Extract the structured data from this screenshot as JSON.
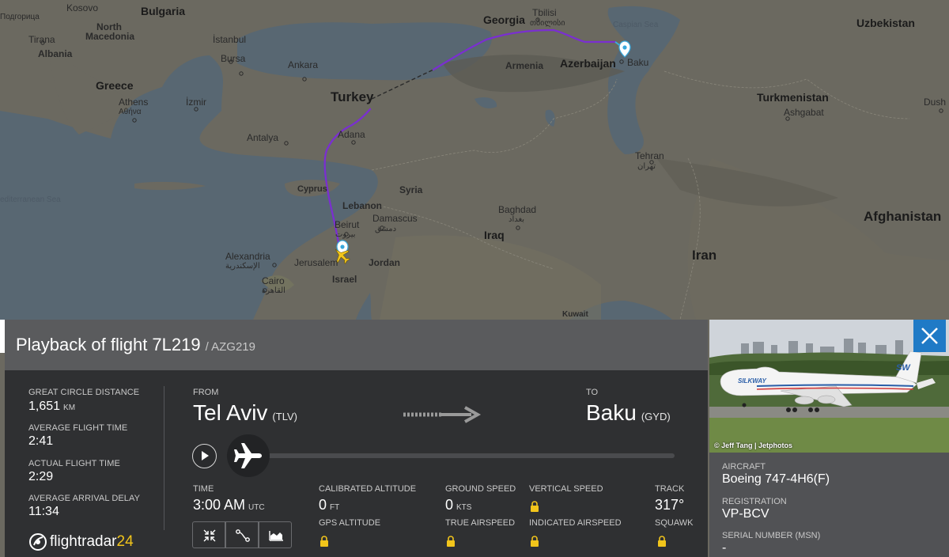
{
  "map": {
    "labels": {
      "kosovo": "Kosovo",
      "bulgaria": "Bulgaria",
      "north_macedonia": "North\nMacedonia",
      "podgorica": "Подгорица",
      "tirana": "Tirana",
      "albania": "Albania",
      "istanbul": "İstanbul",
      "bursa": "Bursa",
      "ankara": "Ankara",
      "izmir": "İzmir",
      "greece": "Greece",
      "athens": "Athens",
      "athens_local": "Αθήνα",
      "turkey": "Turkey",
      "antalya": "Antalya",
      "adana": "Adana",
      "cyprus": "Cyprus",
      "med_sea": "editerranean Sea",
      "syria": "Syria",
      "lebanon": "Lebanon",
      "beirut": "Beirut",
      "beirut_local": "بيروت",
      "damascus": "Damascus",
      "damascus_local": "دمشق",
      "alexandria": "Alexandria",
      "alexandria_local": "الإسكندرية",
      "jerusalem": "Jerusalem",
      "israel": "Israel",
      "jordan": "Jordan",
      "cairo": "Cairo",
      "cairo_local": "القاهرة",
      "georgia": "Georgia",
      "tbilisi": "Tbilisi",
      "tbilisi_local": "თბილისი",
      "armenia": "Armenia",
      "azerbaijan": "Azerbaijan",
      "baku": "Baku",
      "caspian_sea": "Caspian Sea",
      "baghdad": "Baghdad",
      "baghdad_local": "بغداد",
      "iraq": "Iraq",
      "iran": "Iran",
      "tehran": "Tehran",
      "tehran_local": "تهران",
      "kuwait": "Kuwait",
      "turkmenistan": "Turkmenistan",
      "ashgabat": "Ashgabat",
      "uzbekistan": "Uzbekistan",
      "afghanistan": "Afghanistan",
      "dushanbe_partial": "Dush"
    },
    "colors": {
      "land": "#6c6a62",
      "land_dark": "#58584f",
      "water": "#596973",
      "track": "#7a2fd0",
      "track_dashed": "#2a2a2a",
      "pin": "#38a8dc"
    }
  },
  "panel": {
    "title": "Playback of flight 7L219",
    "subtitle": "/ AZG219",
    "stats": [
      {
        "label": "Great circle distance",
        "value": "1,651",
        "unit": "KM"
      },
      {
        "label": "Average flight time",
        "value": "2:41",
        "unit": ""
      },
      {
        "label": "Actual flight time",
        "value": "2:29",
        "unit": ""
      },
      {
        "label": "Average arrival delay",
        "value": "11:34",
        "unit": ""
      }
    ],
    "from_label": "FROM",
    "from_city": "Tel Aviv",
    "from_code": "(TLV)",
    "to_label": "TO",
    "to_city": "Baku",
    "to_code": "(GYD)",
    "progress": 0.0,
    "time_label": "TIME",
    "time_value": "3:00 AM",
    "time_unit": "UTC",
    "cal_alt_label": "CALIBRATED ALTITUDE",
    "cal_alt_value": "0",
    "cal_alt_unit": "FT",
    "gps_alt_label": "GPS ALTITUDE",
    "ground_speed_label": "GROUND SPEED",
    "ground_speed_value": "0",
    "ground_speed_unit": "KTS",
    "true_airspeed_label": "TRUE AIRSPEED",
    "vertical_speed_label": "VERTICAL SPEED",
    "indicated_airspeed_label": "INDICATED AIRSPEED",
    "track_label": "TRACK",
    "track_value": "317°",
    "squawk_label": "SQUAWK",
    "logo_text": "flightradar",
    "logo_num": "24",
    "toolbar": [
      "collapse-icon",
      "route-icon",
      "chart-icon"
    ]
  },
  "aircraft": {
    "photo_credit": "© Jeff Tang | Jetphotos",
    "airline_tail": "SW",
    "airline_fuselage": "SILKWAY",
    "aircraft_label": "AIRCRAFT",
    "aircraft_value": "Boeing 747-4H6(F)",
    "registration_label": "REGISTRATION",
    "registration_value": "VP-BCV",
    "serial_label": "SERIAL NUMBER (MSN)",
    "serial_value": "-"
  }
}
